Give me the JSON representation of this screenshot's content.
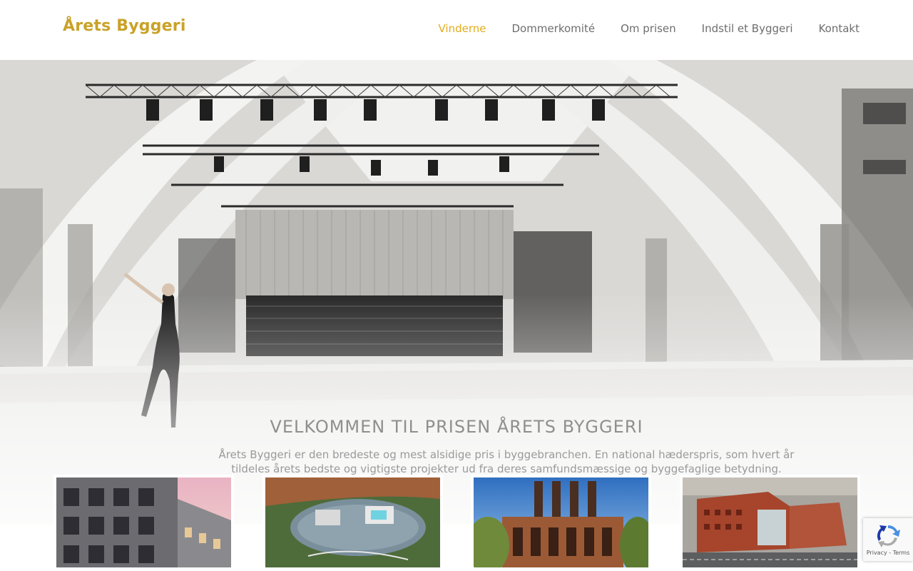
{
  "header": {
    "logo": "Årets Byggeri",
    "nav": [
      {
        "label": "Vinderne",
        "active": true
      },
      {
        "label": "Dommerkomité",
        "active": false
      },
      {
        "label": "Om prisen",
        "active": false
      },
      {
        "label": "Indstil et Byggeri",
        "active": false
      },
      {
        "label": "Kontakt",
        "active": false
      }
    ]
  },
  "hero": {
    "title": "VELKOMMEN TIL PRISEN ÅRETS BYGGERI",
    "text": "Årets Byggeri er den bredeste og mest alsidige pris i byggebranchen. En national hæderspris, som hvert år tildeles årets bedste og vigtigste projekter ud fra deres samfundsmæssige og byggefaglige betydning."
  },
  "recaptcha": {
    "links": "Privacy - Terms"
  },
  "colors": {
    "accent": "#e2ac1c",
    "logo": "#c9a227",
    "nav_text": "#6e6e6e"
  }
}
